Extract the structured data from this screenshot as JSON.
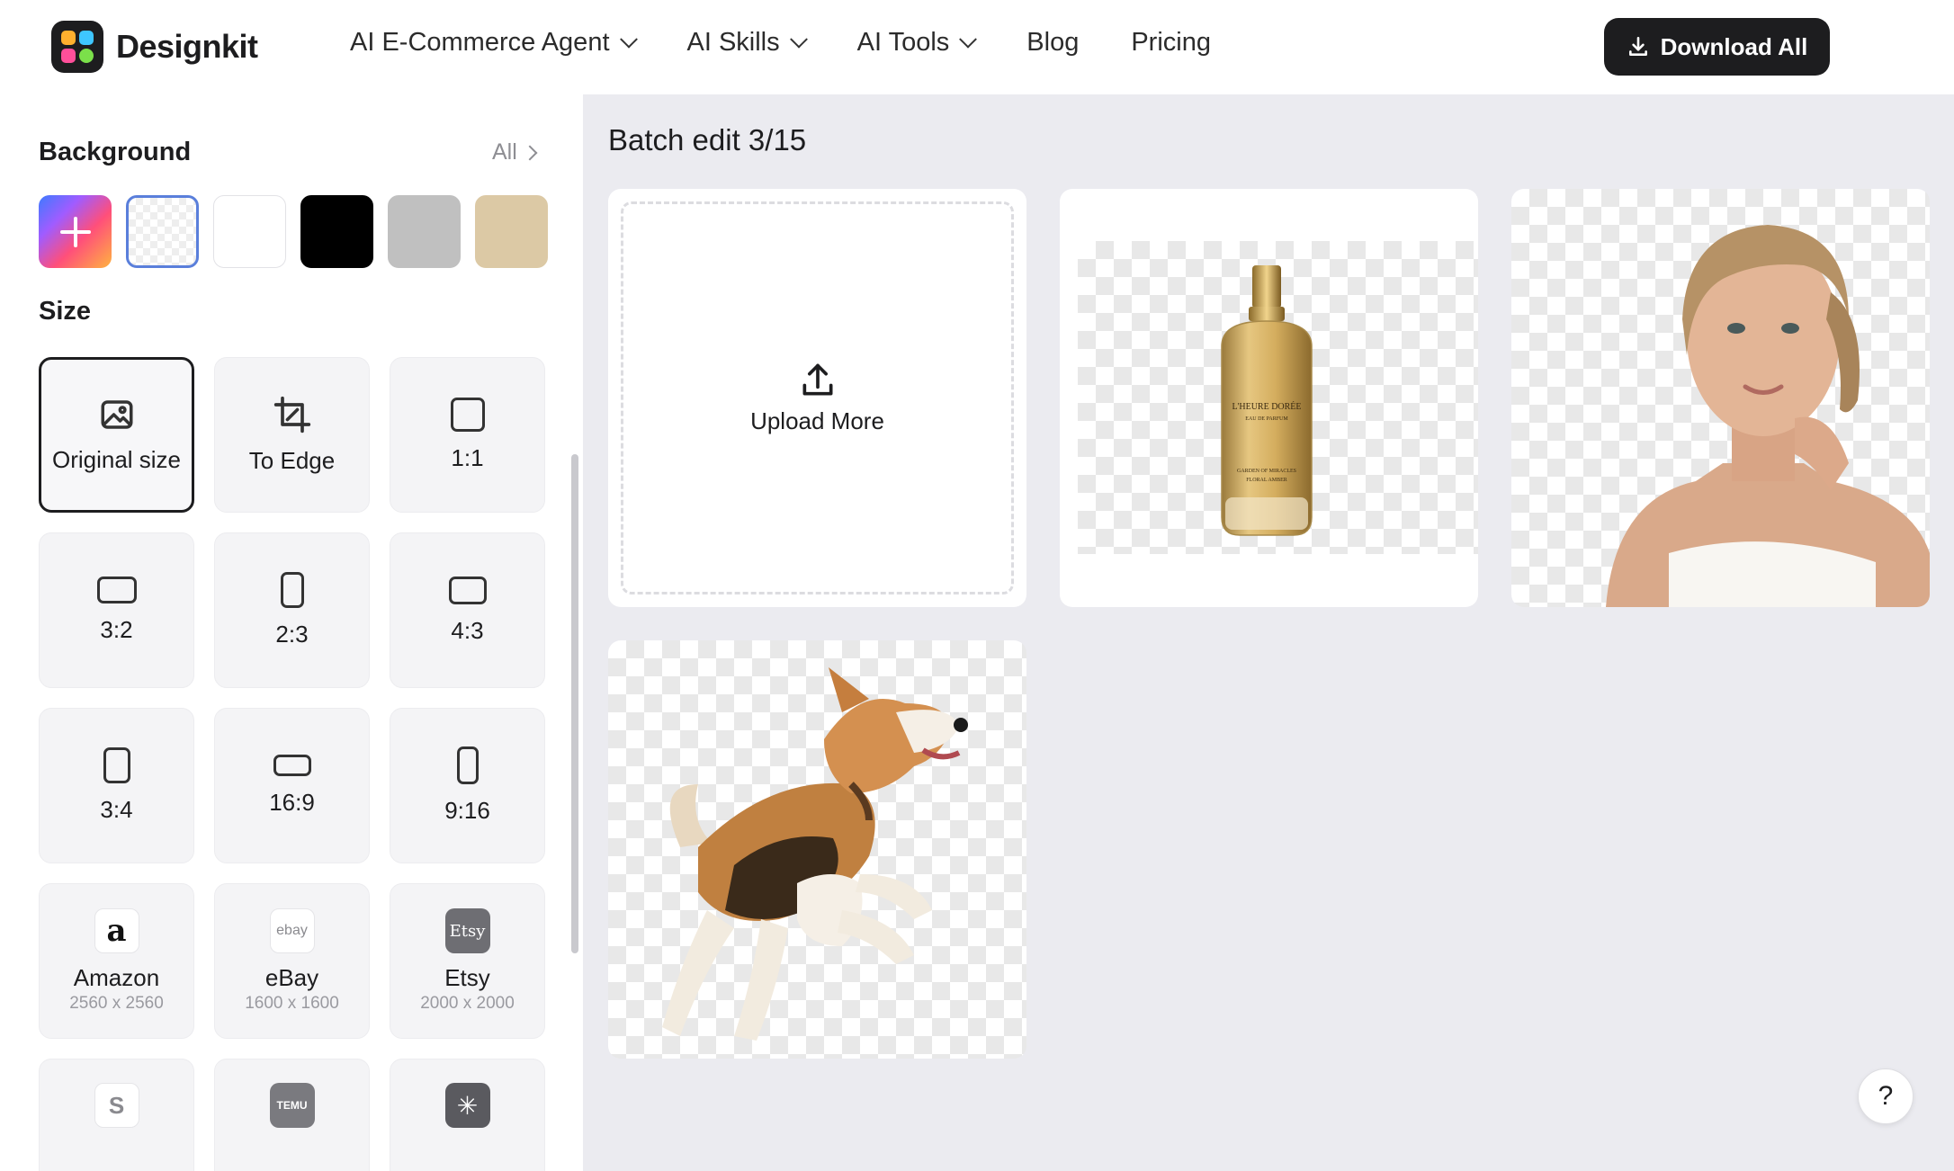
{
  "app": {
    "name": "Designkit"
  },
  "nav": {
    "items": [
      {
        "label": "AI E-Commerce Agent",
        "has_dropdown": true
      },
      {
        "label": "AI Skills",
        "has_dropdown": true
      },
      {
        "label": "AI Tools",
        "has_dropdown": true
      },
      {
        "label": "Blog",
        "has_dropdown": false
      },
      {
        "label": "Pricing",
        "has_dropdown": false
      }
    ],
    "download_all": "Download All"
  },
  "sidebar": {
    "background": {
      "title": "Background",
      "all_link": "All",
      "swatches": [
        {
          "name": "add-custom",
          "color": "gradient"
        },
        {
          "name": "transparent",
          "color": "transparent",
          "selected": true
        },
        {
          "name": "white",
          "color": "#ffffff"
        },
        {
          "name": "black",
          "color": "#000000"
        },
        {
          "name": "gray",
          "color": "#c0c0c0"
        },
        {
          "name": "beige",
          "color": "#dcc9a5"
        }
      ]
    },
    "size": {
      "title": "Size",
      "options": [
        {
          "label": "Original size",
          "icon": "image-icon",
          "selected": true
        },
        {
          "label": "To Edge",
          "icon": "crop-icon"
        },
        {
          "label": "1:1",
          "icon": "ratio-1-1-icon"
        },
        {
          "label": "3:2",
          "icon": "ratio-3-2-icon"
        },
        {
          "label": "2:3",
          "icon": "ratio-2-3-icon"
        },
        {
          "label": "4:3",
          "icon": "ratio-4-3-icon"
        },
        {
          "label": "3:4",
          "icon": "ratio-3-4-icon"
        },
        {
          "label": "16:9",
          "icon": "ratio-16-9-icon"
        },
        {
          "label": "9:16",
          "icon": "ratio-9-16-icon"
        },
        {
          "label": "Amazon",
          "sub": "2560 x 2560",
          "icon": "amazon-icon",
          "glyph": "a"
        },
        {
          "label": "eBay",
          "sub": "1600 x 1600",
          "icon": "ebay-icon",
          "glyph": "ebay"
        },
        {
          "label": "Etsy",
          "sub": "2000 x 2000",
          "icon": "etsy-icon",
          "glyph": "Etsy"
        },
        {
          "label": "",
          "icon": "shopify-icon",
          "glyph": "S"
        },
        {
          "label": "",
          "icon": "temu-icon",
          "glyph": "TEMU"
        },
        {
          "label": "",
          "icon": "walmart-icon",
          "glyph": "✳"
        }
      ]
    }
  },
  "main": {
    "title": "Batch edit 3/15",
    "upload_label": "Upload More",
    "images": [
      {
        "name": "perfume-bottle",
        "bottle_text": [
          "L'HEURE DORÉE",
          "EAU DE PARFUM",
          "GARDEN OF MIRACLES",
          "FLORAL AMBER"
        ]
      },
      {
        "name": "woman-portrait"
      },
      {
        "name": "jumping-dog"
      }
    ]
  },
  "help": {
    "label": "?"
  }
}
